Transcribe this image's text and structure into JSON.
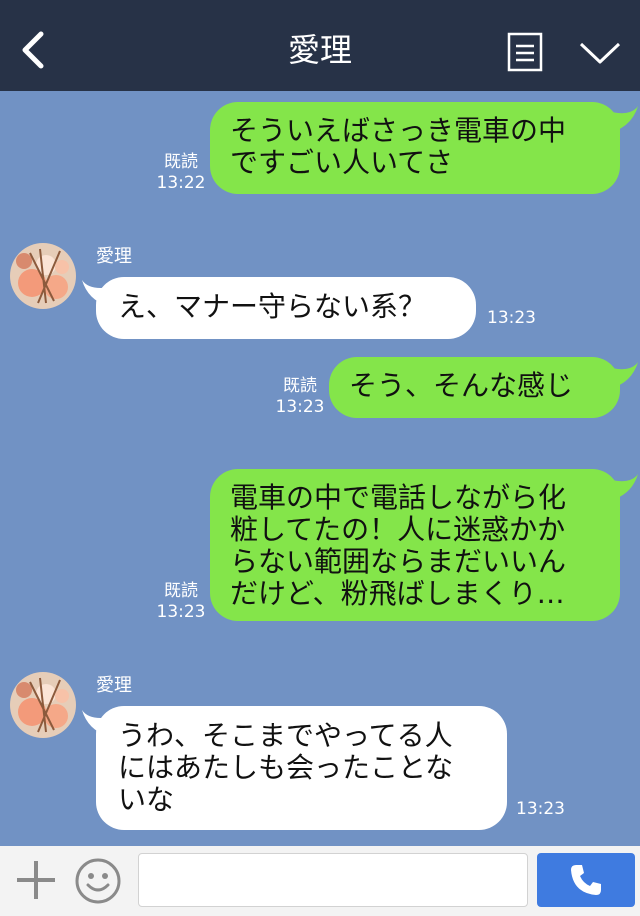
{
  "header": {
    "title": "愛理",
    "back_icon": "chevron-left-icon",
    "notes_icon": "notes-icon",
    "menu_icon": "chevron-down-icon",
    "background": "#273247"
  },
  "chat": {
    "background": "#7192c4",
    "outgoing_color": "#84e54a",
    "incoming_color": "#ffffff",
    "messages": [
      {
        "direction": "out",
        "text": "そういえばさっき電車の中\nですごい人いてさ",
        "read": "既読",
        "time": "13:22"
      },
      {
        "direction": "in",
        "sender": "愛理",
        "text": "え、マナー守らない系？",
        "time": "13:23"
      },
      {
        "direction": "out",
        "text": "そう、そんな感じ",
        "read": "既読",
        "time": "13:23"
      },
      {
        "direction": "out",
        "text": "電車の中で電話しながら化\n粧してたの！人に迷惑かか\nらない範囲ならまだいいん\nだけど、粉飛ばしまくり…",
        "read": "既読",
        "time": "13:23"
      },
      {
        "direction": "in",
        "sender": "愛理",
        "text": "うわ、そこまでやってる人\nにはあたしも会ったことな\nいな",
        "time": "13:23"
      }
    ]
  },
  "footer": {
    "plus_icon": "plus-icon",
    "sticker_icon": "smiley-icon",
    "input_value": "",
    "call_icon": "phone-icon",
    "call_color": "#3f7be0"
  }
}
